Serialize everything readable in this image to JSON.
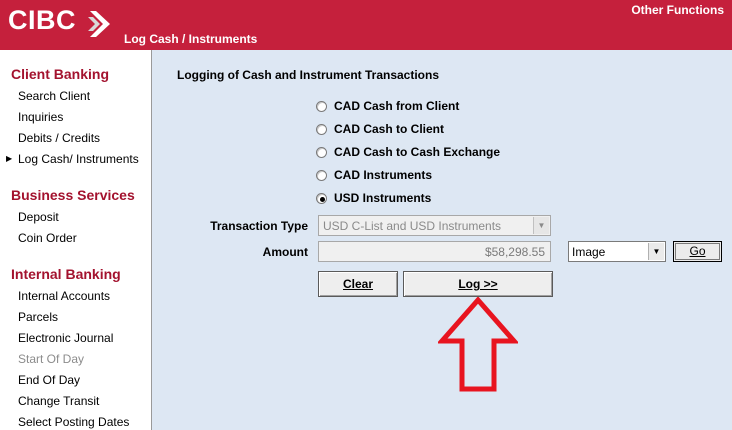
{
  "header": {
    "logo_text": "CIBC",
    "page_title": "Log Cash / Instruments",
    "other_functions": "Other Functions",
    "brand_color": "#c5203c"
  },
  "sidebar": {
    "sections": [
      {
        "heading": "Client Banking",
        "items": [
          {
            "label": "Search Client"
          },
          {
            "label": "Inquiries"
          },
          {
            "label": "Debits / Credits"
          },
          {
            "label": "Log Cash/ Instruments",
            "current": true
          }
        ]
      },
      {
        "heading": "Business Services",
        "items": [
          {
            "label": "Deposit"
          },
          {
            "label": "Coin Order"
          }
        ]
      },
      {
        "heading": "Internal Banking",
        "items": [
          {
            "label": "Internal Accounts"
          },
          {
            "label": "Parcels"
          },
          {
            "label": "Electronic Journal"
          },
          {
            "label": "Start Of Day",
            "disabled": true
          },
          {
            "label": "End Of Day"
          },
          {
            "label": "Change Transit"
          },
          {
            "label": "Select Posting Dates"
          }
        ]
      }
    ]
  },
  "main": {
    "title": "Logging of Cash and Instrument Transactions",
    "options": [
      {
        "label": "CAD Cash from Client",
        "checked": false
      },
      {
        "label": "CAD Cash to Client",
        "checked": false
      },
      {
        "label": "CAD Cash to Cash Exchange",
        "checked": false
      },
      {
        "label": "CAD Instruments",
        "checked": false
      },
      {
        "label": "USD Instruments",
        "checked": true
      }
    ],
    "transaction_type_label": "Transaction Type",
    "transaction_type_value": "USD C-List and USD Instruments",
    "amount_label": "Amount",
    "amount_value": "$58,298.55",
    "image_select_value": "Image",
    "go_label": "Go",
    "clear_label": "Clear",
    "log_label": "Log >>"
  },
  "annotation": {
    "arrow_color": "#e8141f",
    "arrow_icon": "up-arrow-icon"
  }
}
